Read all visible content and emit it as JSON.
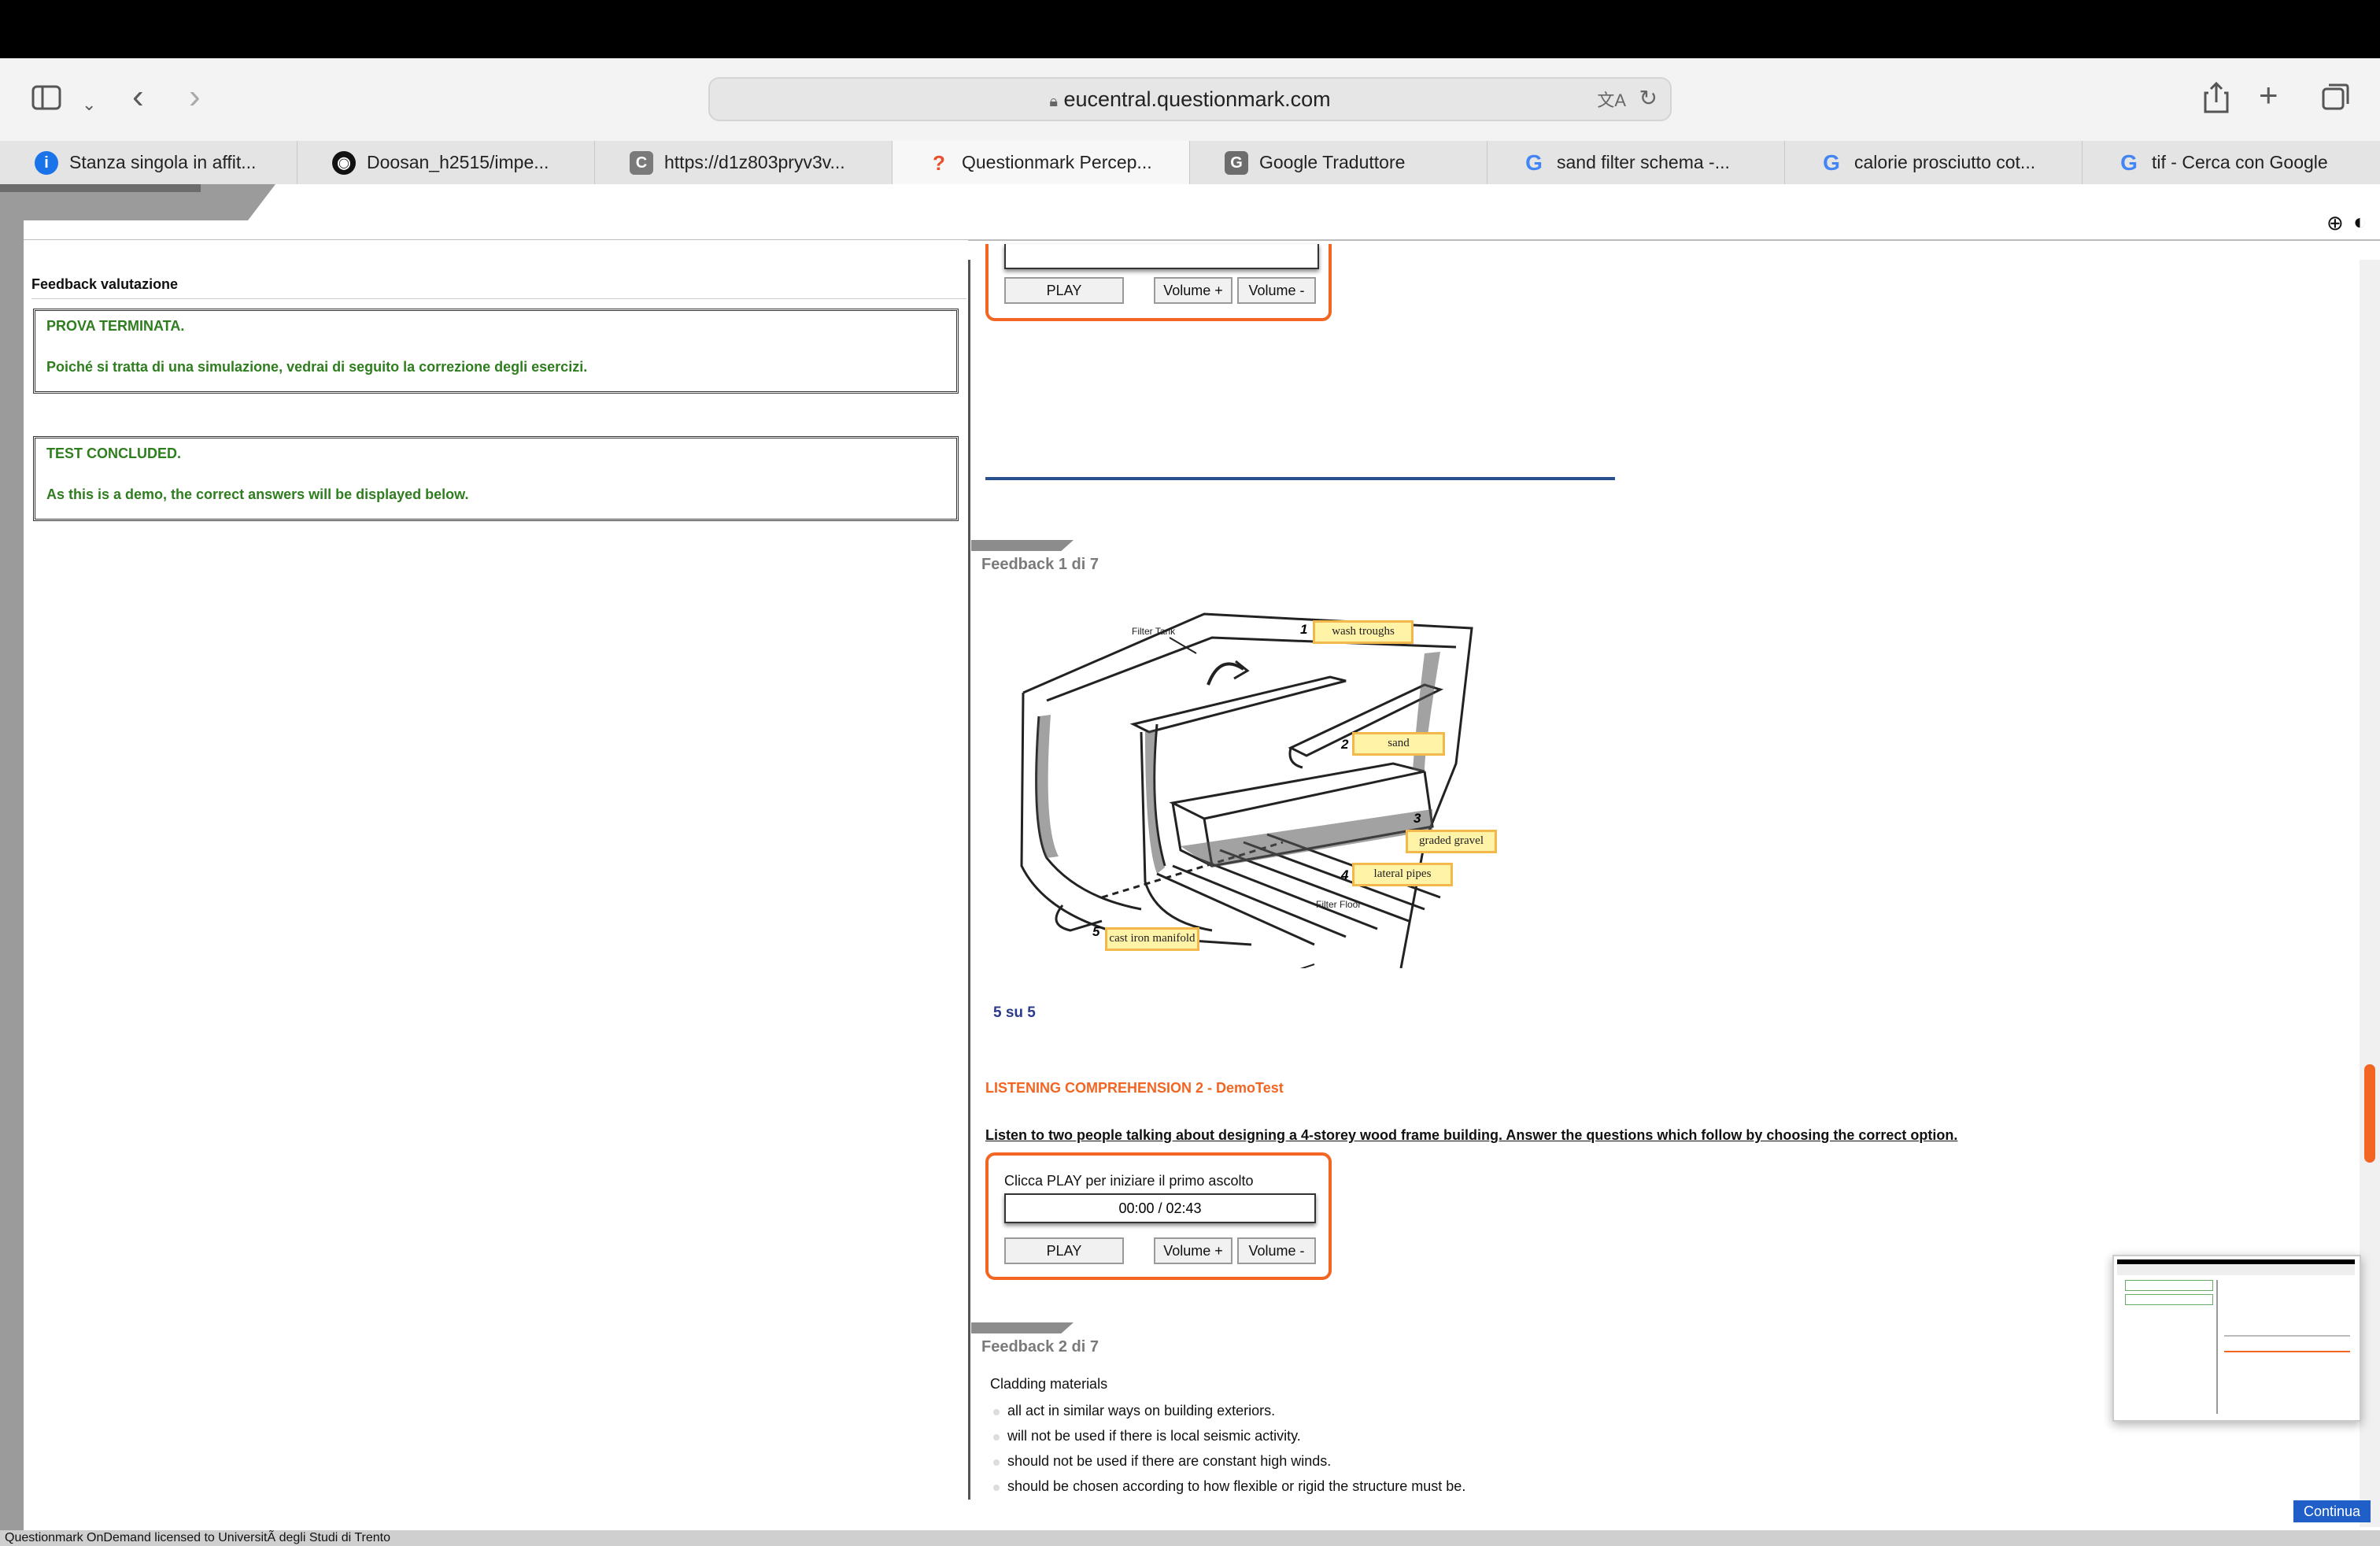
{
  "browser": {
    "url": "eucentral.questionmark.com",
    "tabs": [
      {
        "label": "Stanza singola in affit...",
        "icon": "info-icon",
        "color": "#1a73e8"
      },
      {
        "label": "Doosan_h2515/impe...",
        "icon": "github-icon",
        "color": "#111111"
      },
      {
        "label": "https://d1z803pryv3v...",
        "icon": "c-icon",
        "color": "#7a7a7a"
      },
      {
        "label": "Questionmark Percep...",
        "icon": "questionmark-icon",
        "color": "#e94e2b",
        "active": true
      },
      {
        "label": "Google Traduttore",
        "icon": "google-translate-icon",
        "color": "#6d6d6d"
      },
      {
        "label": "sand filter schema -...",
        "icon": "google-icon",
        "color": "#4285f4"
      },
      {
        "label": "calorie prosciutto cot...",
        "icon": "google-icon",
        "color": "#4285f4"
      },
      {
        "label": "tif - Cerca con Google",
        "icon": "google-icon",
        "color": "#4285f4"
      }
    ]
  },
  "left": {
    "heading": "Feedback valutazione",
    "box1": {
      "line1": "PROVA TERMINATA.",
      "line2": "Poiché si tratta di una simulazione, vedrai di seguito la correzione degli esercizi."
    },
    "box2": {
      "line1": "TEST CONCLUDED.",
      "line2": "As this is a demo, the correct answers will be displayed below."
    }
  },
  "player1": {
    "play": "PLAY",
    "vol_up": "Volume +",
    "vol_down": "Volume -"
  },
  "feedback1": {
    "label": "Feedback 1 di  7",
    "diagram": {
      "filter_tank": "Filter Tank",
      "filter_floor": "Filter Floor",
      "tags": [
        {
          "n": "1",
          "text": "wash troughs"
        },
        {
          "n": "2",
          "text": "sand"
        },
        {
          "n": "3",
          "text": "graded gravel"
        },
        {
          "n": "4",
          "text": "lateral pipes"
        },
        {
          "n": "5",
          "text": "cast iron manifold"
        }
      ]
    },
    "score": "5  su  5"
  },
  "section2": {
    "title": "LISTENING COMPREHENSION 2 - DemoTest",
    "instruction": "Listen to two people talking about designing a 4-storey wood frame building. Answer the questions which follow by choosing the correct option.",
    "player": {
      "prompt": "Clicca PLAY per iniziare il primo ascolto",
      "time": "00:00 / 02:43",
      "play": "PLAY",
      "vol_up": "Volume +",
      "vol_down": "Volume -"
    }
  },
  "feedback2": {
    "label": "Feedback 2 di  7",
    "question": "Cladding materials",
    "options": [
      "all act in similar ways on building exteriors.",
      "will not be used if there is local seismic activity.",
      "should not be used if there are constant high winds.",
      "should be chosen according to how flexible or rigid the structure must be."
    ]
  },
  "continue_button": "Continua",
  "footer": "Questionmark OnDemand licensed to UniversitÃ  degli Studi di Trento",
  "colors": {
    "accent_orange": "#f26522",
    "feedback_green": "#2e7d1e",
    "score_blue": "#2b3a8c",
    "divider_blue": "#2a4f8f"
  }
}
